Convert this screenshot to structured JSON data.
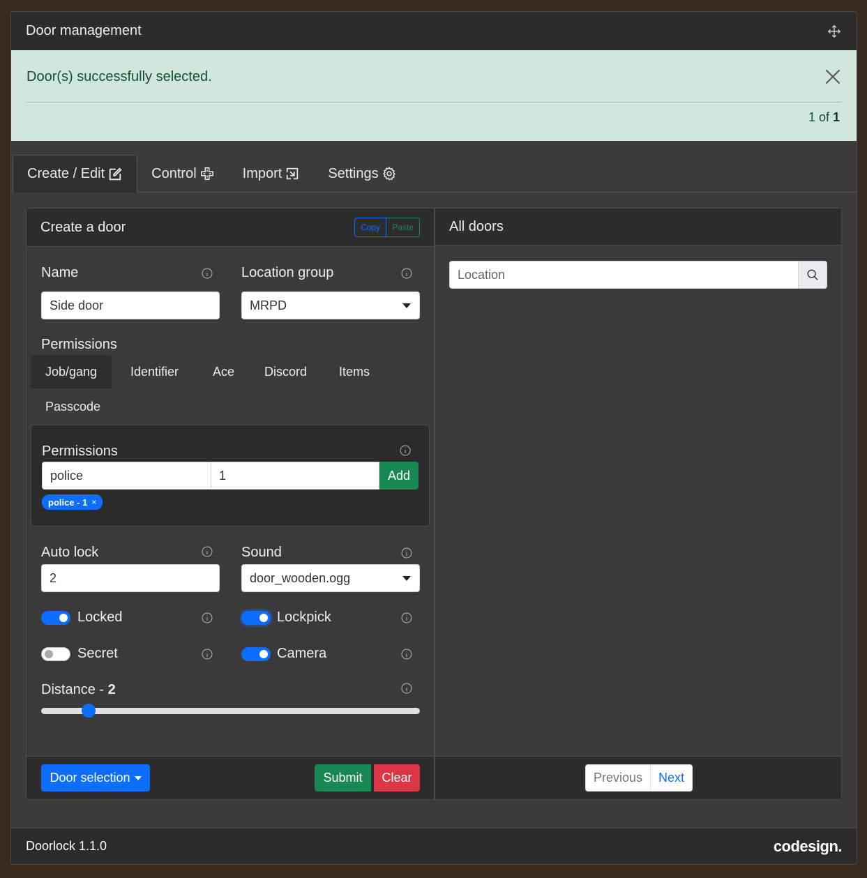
{
  "window": {
    "title": "Door management"
  },
  "alert": {
    "message": "Door(s) successfully selected.",
    "counter_prefix": "1 of ",
    "counter_total": "1"
  },
  "tabs": [
    {
      "label": "Create / Edit",
      "icon": "edit-icon"
    },
    {
      "label": "Control",
      "icon": "control-icon"
    },
    {
      "label": "Import",
      "icon": "import-icon"
    },
    {
      "label": "Settings",
      "icon": "gear-icon"
    }
  ],
  "create": {
    "header": "Create a door",
    "copy_label": "Copy",
    "paste_label": "Paste",
    "name_label": "Name",
    "name_value": "Side door",
    "location_group_label": "Location group",
    "location_group_value": "MRPD",
    "permissions_label": "Permissions",
    "perm_tabs": [
      "Job/gang",
      "Identifier",
      "Ace",
      "Discord",
      "Items",
      "Passcode"
    ],
    "perm_box_label": "Permissions",
    "perm_job_value": "police",
    "perm_grade_value": "1",
    "add_label": "Add",
    "badge_label": "police - 1",
    "badge_close": "×",
    "autolock_label": "Auto lock",
    "autolock_value": "2",
    "sound_label": "Sound",
    "sound_value": "door_wooden.ogg",
    "toggles": [
      {
        "label": "Locked",
        "on": true
      },
      {
        "label": "Lockpick",
        "on": true
      },
      {
        "label": "Secret",
        "on": false
      },
      {
        "label": "Camera",
        "on": true
      }
    ],
    "distance_label": "Distance - ",
    "distance_value": "2",
    "distance_fraction": 0.125,
    "door_selection_label": "Door selection",
    "submit_label": "Submit",
    "clear_label": "Clear"
  },
  "all_doors": {
    "header": "All doors",
    "search_placeholder": "Location",
    "prev_label": "Previous",
    "next_label": "Next"
  },
  "footer": {
    "version": "Doorlock 1.1.0",
    "brand": "codesign."
  }
}
